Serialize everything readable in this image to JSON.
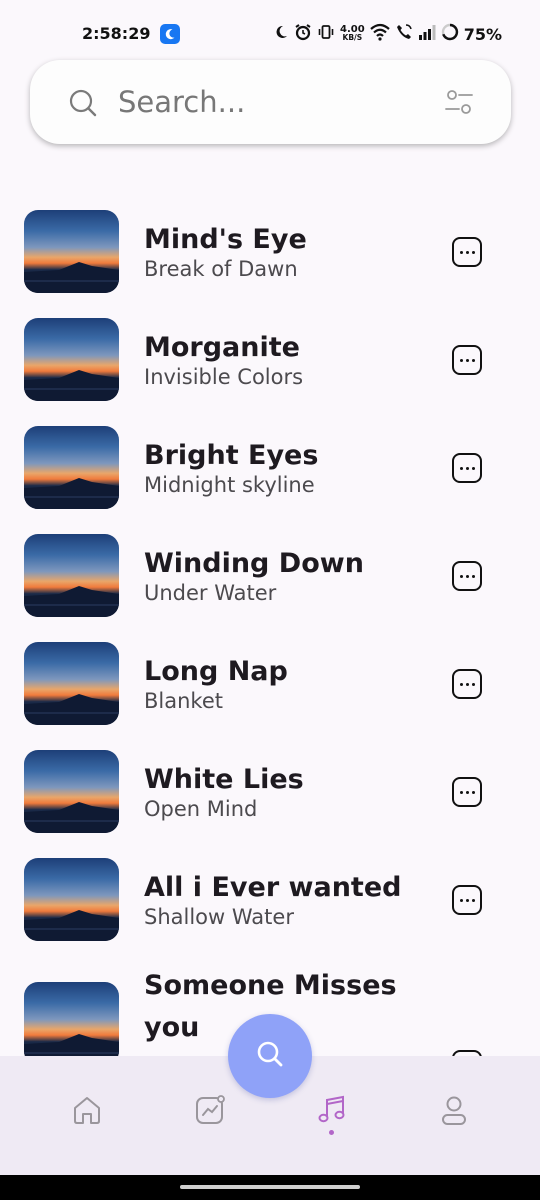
{
  "status_bar": {
    "time": "2:58:29",
    "net_speed_value": "4.00",
    "net_speed_unit": "KB/S",
    "battery": "75%"
  },
  "search": {
    "placeholder": "Search...",
    "value": ""
  },
  "songs": [
    {
      "title": "Mind's Eye",
      "artist": "Break of Dawn"
    },
    {
      "title": "Morganite",
      "artist": "Invisible Colors"
    },
    {
      "title": "Bright Eyes",
      "artist": "Midnight skyline"
    },
    {
      "title": "Winding Down",
      "artist": "Under Water"
    },
    {
      "title": "Long Nap",
      "artist": "Blanket"
    },
    {
      "title": "White Lies",
      "artist": "Open Mind"
    },
    {
      "title": "All i Ever wanted",
      "artist": "Shallow Water"
    },
    {
      "title": "Someone Misses you",
      "artist": ""
    }
  ],
  "bottom_nav": {
    "items": [
      {
        "icon": "home-icon"
      },
      {
        "icon": "stats-icon"
      },
      {
        "icon": "music-note-icon",
        "active": true
      },
      {
        "icon": "profile-icon"
      }
    ],
    "active_color": "#b266c8",
    "inactive_color": "#9a969c"
  },
  "fab": {
    "icon": "search-icon",
    "color": "#8fa2f8"
  }
}
